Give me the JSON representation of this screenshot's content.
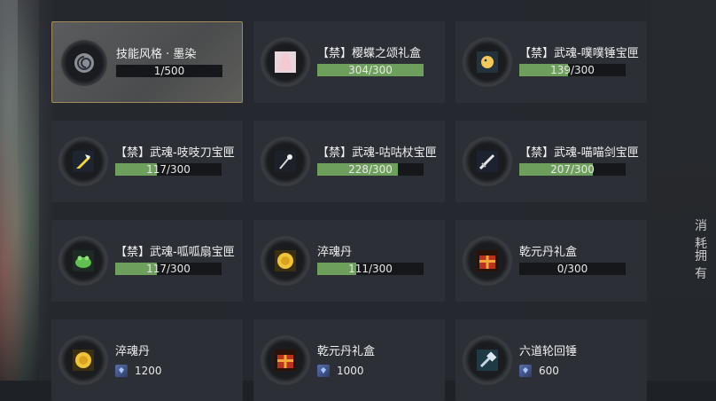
{
  "side": {
    "label1": "消耗",
    "label2": "拥有"
  },
  "colors": {
    "progress": "#6f9f5c",
    "selected_border": "#a08a58"
  },
  "items": [
    {
      "name": "技能风格 · 墨染",
      "progress": "1/500",
      "fill": 0.002,
      "icon": "swirl-icon"
    },
    {
      "name": "【禁】樱蝶之颂礼盒",
      "progress": "304/300",
      "fill": 1.0,
      "icon": "dress-icon"
    },
    {
      "name": "【禁】武魂-噗噗锤宝匣",
      "progress": "139/300",
      "fill": 0.46,
      "icon": "pufferfish-icon"
    },
    {
      "name": "【禁】武魂-吱吱刀宝匣",
      "progress": "117/300",
      "fill": 0.39,
      "icon": "feather-blade-icon"
    },
    {
      "name": "【禁】武魂-咕咕杖宝匣",
      "progress": "228/300",
      "fill": 0.76,
      "icon": "staff-icon"
    },
    {
      "name": "【禁】武魂-喵喵剑宝匣",
      "progress": "207/300",
      "fill": 0.69,
      "icon": "sword-icon"
    },
    {
      "name": "【禁】武魂-呱呱扇宝匣",
      "progress": "117/300",
      "fill": 0.39,
      "icon": "frog-fan-icon"
    },
    {
      "name": "淬魂丹",
      "progress": "111/300",
      "fill": 0.37,
      "icon": "gold-coin-icon"
    },
    {
      "name": "乾元丹礼盒",
      "progress": "0/300",
      "fill": 0.0,
      "icon": "gift-box-icon"
    },
    {
      "name": "淬魂丹",
      "cost": "1200",
      "icon": "gold-coin-icon"
    },
    {
      "name": "乾元丹礼盒",
      "cost": "1000",
      "icon": "gift-box-icon"
    },
    {
      "name": "六道轮回锤",
      "cost": "600",
      "icon": "hammer-icon"
    }
  ]
}
